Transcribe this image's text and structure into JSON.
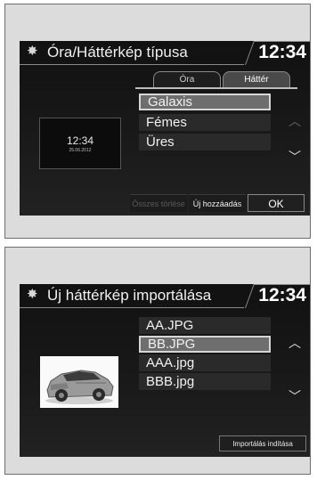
{
  "screen1": {
    "title": "Óra/Háttérkép típusa",
    "clock": "12:34",
    "tabs": [
      {
        "label": "Óra"
      },
      {
        "label": "Háttér"
      }
    ],
    "items": [
      {
        "label": "Galaxis",
        "selected": true
      },
      {
        "label": "Fémes",
        "selected": false
      },
      {
        "label": "Üres",
        "selected": false
      }
    ],
    "preview": {
      "time": "12:34",
      "date": "25.06.2012"
    },
    "buttons": {
      "delete_all": "Összes törlése",
      "add_new": "Új hozzáadás",
      "ok": "OK"
    },
    "icons": {
      "settings": "gear-icon",
      "up": "chevron-up-icon",
      "down": "chevron-down-icon"
    }
  },
  "screen2": {
    "title": "Új háttérkép importálása",
    "clock": "12:34",
    "items": [
      {
        "label": "AA.JPG",
        "selected": false
      },
      {
        "label": "BB.JPG",
        "selected": true
      },
      {
        "label": "AAA.jpg",
        "selected": false
      },
      {
        "label": "BBB.jpg",
        "selected": false
      }
    ],
    "buttons": {
      "start_import": "Importálás indítása"
    },
    "icons": {
      "settings": "gear-icon",
      "up": "chevron-up-icon",
      "down": "chevron-down-icon",
      "preview": "car-image"
    }
  }
}
